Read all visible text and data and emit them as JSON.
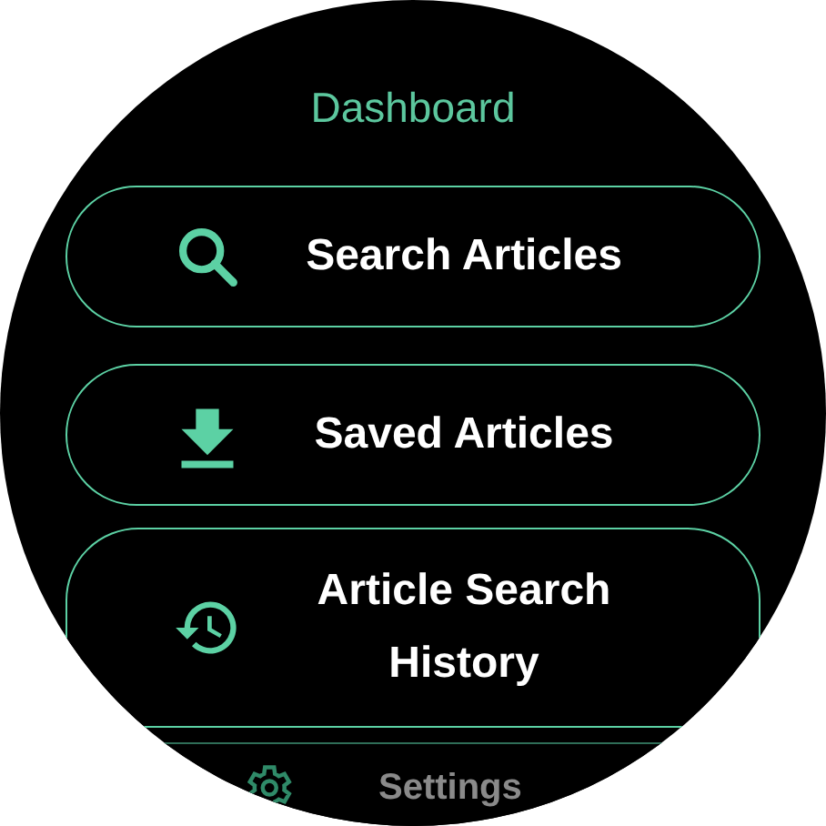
{
  "title": "Dashboard",
  "items": [
    {
      "label": "Search Articles"
    },
    {
      "label": "Saved Articles"
    },
    {
      "label": "Article Search History"
    }
  ],
  "footer_item": {
    "label": "Settings"
  }
}
